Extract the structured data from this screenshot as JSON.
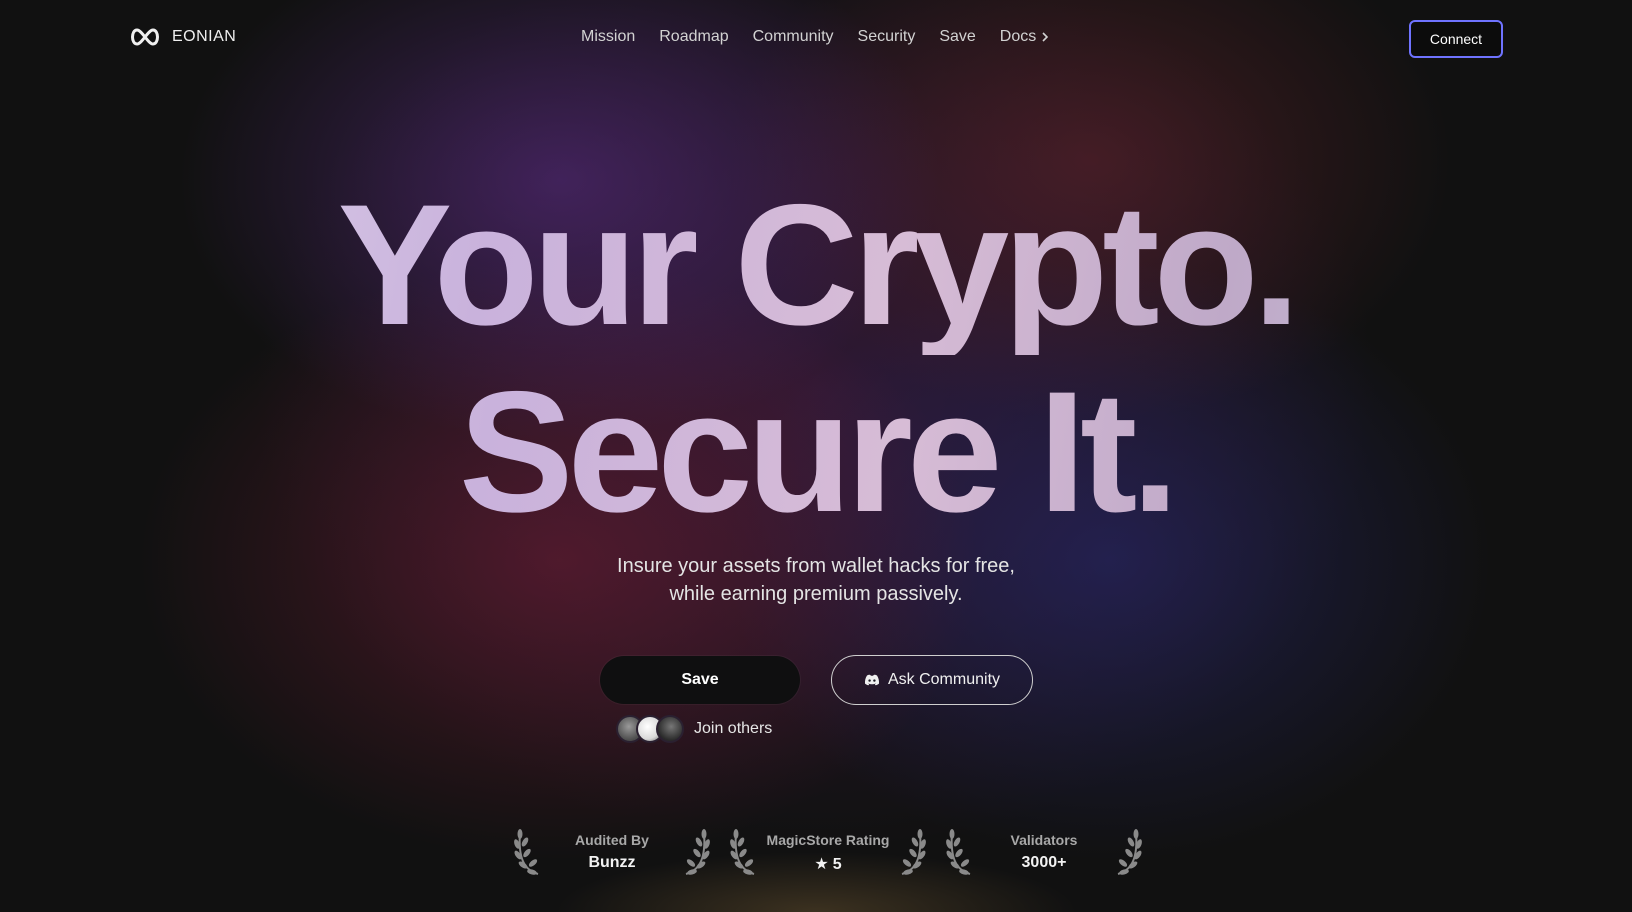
{
  "brand": {
    "name": "EONIAN",
    "icon": "infinity-icon"
  },
  "nav": {
    "items": [
      {
        "label": "Mission"
      },
      {
        "label": "Roadmap"
      },
      {
        "label": "Community"
      },
      {
        "label": "Security"
      },
      {
        "label": "Save"
      },
      {
        "label": "Docs",
        "icon": "chevron-right-icon"
      }
    ]
  },
  "header": {
    "connect_label": "Connect",
    "accent_color": "#6f73ff"
  },
  "hero": {
    "line1": "Your Crypto.",
    "line2": "Secure It.",
    "subtitle_line1": "Insure your assets from wallet hacks for free,",
    "subtitle_line2": "while earning premium passively."
  },
  "actions": {
    "save_label": "Save",
    "ask_label": "Ask Community",
    "ask_icon": "discord-icon",
    "join_label": "Join others"
  },
  "badges": [
    {
      "label": "Audited By",
      "value": "Bunzz"
    },
    {
      "label": "MagicStore Rating",
      "value": "5",
      "icon": "star-icon"
    },
    {
      "label": "Validators",
      "value": "3000+"
    }
  ]
}
